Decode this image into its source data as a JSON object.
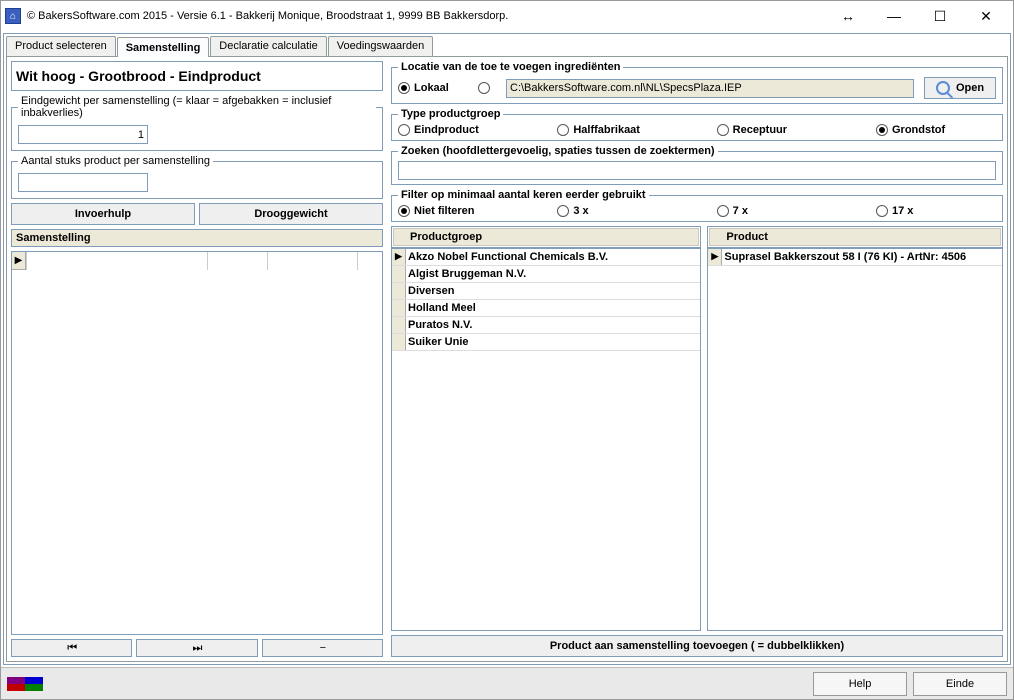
{
  "window": {
    "title": "© BakersSoftware.com 2015 - Versie 6.1 - Bakkerij Monique, Broodstraat 1, 9999 BB Bakkersdorp."
  },
  "tabs": {
    "product_select": "Product selecteren",
    "samenstelling": "Samenstelling",
    "declaratie": "Declaratie calculatie",
    "voedingswaarden": "Voedingswaarden"
  },
  "left": {
    "product_title": "Wit hoog - Grootbrood - Eindproduct",
    "eindgewicht_label": "Eindgewicht per samenstelling (= klaar = afgebakken = inclusief inbakverlies)",
    "eindgewicht_value": "1",
    "aantal_label": "Aantal stuks product per samenstelling",
    "aantal_value": "",
    "btn_invoerhulp": "Invoerhulp",
    "btn_drooggewicht": "Drooggewicht",
    "samenstelling_head": "Samenstelling",
    "nav_first": "⏮",
    "nav_last": "⏭",
    "nav_minus": "−"
  },
  "right": {
    "locatie_legend": "Locatie van de toe te voegen ingrediënten",
    "locatie_lokaal": "Lokaal",
    "locatie_path": "C:\\BakkersSoftware.com.nl\\NL\\SpecsPlaza.IEP",
    "btn_open": "Open",
    "type_legend": "Type productgroep",
    "type_eind": "Eindproduct",
    "type_half": "Halffabrikaat",
    "type_recept": "Receptuur",
    "type_grond": "Grondstof",
    "zoeken_legend": "Zoeken (hoofdlettergevoelig, spaties tussen de zoektermen)",
    "zoeken_value": "",
    "filter_legend": "Filter op minimaal aantal keren eerder gebruikt",
    "filter_0": "Niet filteren",
    "filter_3": "3 x",
    "filter_7": "7 x",
    "filter_17": "17 x",
    "productgroep_head": "Productgroep",
    "productgroep_items": [
      "Akzo Nobel Functional Chemicals B.V.",
      "Algist Bruggeman N.V.",
      "Diversen",
      "Holland Meel",
      "Puratos N.V.",
      "Suiker Unie"
    ],
    "product_head": "Product",
    "product_items": [
      "Suprasel Bakkerszout 58 I (76 KI) - ArtNr: 4506"
    ],
    "add_bar": "Product aan samenstelling toevoegen ( = dubbelklikken)"
  },
  "footer": {
    "help": "Help",
    "einde": "Einde"
  },
  "colors": {
    "purple": "#800080",
    "blue": "#0000d0",
    "red": "#c00000",
    "green": "#008000"
  }
}
